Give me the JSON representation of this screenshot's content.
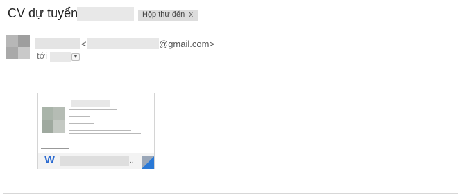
{
  "subject": {
    "title": "CV dự tuyển",
    "label_chip": "Hộp thư đến",
    "label_remove": "x"
  },
  "header": {
    "email_open": "<",
    "email_domain": "@gmail.com>",
    "to_label": "tới",
    "details_toggle": "▼"
  },
  "attachment": {
    "file_type_icon": "W",
    "filename_suffix": "..",
    "type": "word-document",
    "accent_color": "#2a79d6"
  }
}
